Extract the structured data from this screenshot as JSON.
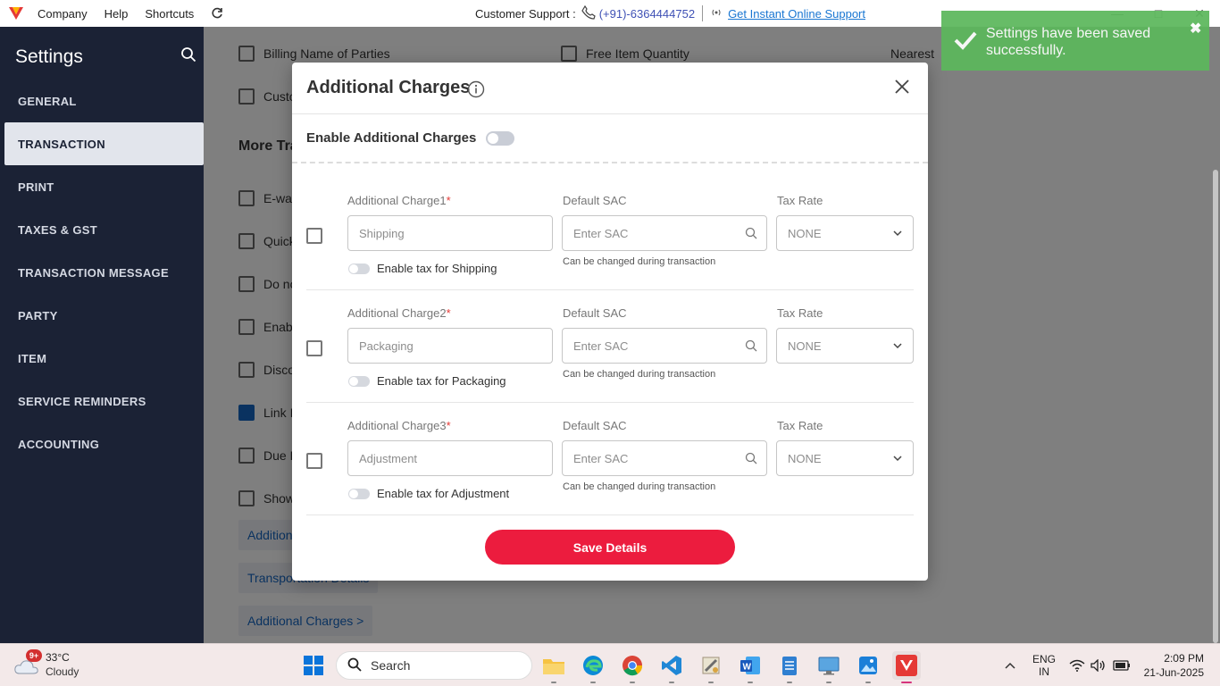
{
  "topbar": {
    "menu": [
      "Company",
      "Help",
      "Shortcuts"
    ],
    "support_label": "Customer Support :",
    "phone": "(+91)-6364444752",
    "online_support": "Get Instant Online Support"
  },
  "sidebar": {
    "title": "Settings",
    "items": [
      "GENERAL",
      "TRANSACTION",
      "PRINT",
      "TAXES & GST",
      "TRANSACTION MESSAGE",
      "PARTY",
      "ITEM",
      "SERVICE REMINDERS",
      "ACCOUNTING"
    ],
    "active": "TRANSACTION"
  },
  "background": {
    "billing_name": "Billing Name of Parties",
    "free_item_qty": "Free Item Quantity",
    "nearest": "Nearest",
    "custo": "Custo",
    "more_tra": "More Tra",
    "rows": [
      "E-way",
      "Quick",
      "Do no",
      "Enab",
      "Disco",
      "Link I",
      "Due D",
      "Show"
    ],
    "link_additiona": "Additiona",
    "link_transport": "Transportation Details",
    "link_additional_charges": "Additional Charges >"
  },
  "modal": {
    "title": "Additional Charges",
    "enable_label": "Enable Additional Charges",
    "charges": [
      {
        "label": "Additional Charge1",
        "value": "Shipping",
        "sac_label": "Default SAC",
        "sac_placeholder": "Enter SAC",
        "tax_label": "Tax Rate",
        "tax_value": "NONE",
        "hint": "Can be changed during transaction",
        "toggle_label": "Enable tax for Shipping"
      },
      {
        "label": "Additional Charge2",
        "value": "Packaging",
        "sac_label": "Default SAC",
        "sac_placeholder": "Enter SAC",
        "tax_label": "Tax Rate",
        "tax_value": "NONE",
        "hint": "Can be changed during transaction",
        "toggle_label": "Enable tax for Packaging"
      },
      {
        "label": "Additional Charge3",
        "value": "Adjustment",
        "sac_label": "Default SAC",
        "sac_placeholder": "Enter SAC",
        "tax_label": "Tax Rate",
        "tax_value": "NONE",
        "hint": "Can be changed during transaction",
        "toggle_label": "Enable tax for Adjustment"
      }
    ],
    "required_mark": "*",
    "save_label": "Save Details"
  },
  "toast": {
    "message": "Settings have been saved successfully."
  },
  "taskbar": {
    "temperature": "33°C",
    "condition": "Cloudy",
    "badge": "9+",
    "search_label": "Search",
    "lang_top": "ENG",
    "lang_bottom": "IN",
    "time": "2:09 PM",
    "date": "21-Jun-2025"
  },
  "colors": {
    "sidebar_bg": "#1b2235",
    "save_button": "#ec1c3e",
    "toast_bg": "#5cb85c",
    "link": "#1565c0"
  }
}
